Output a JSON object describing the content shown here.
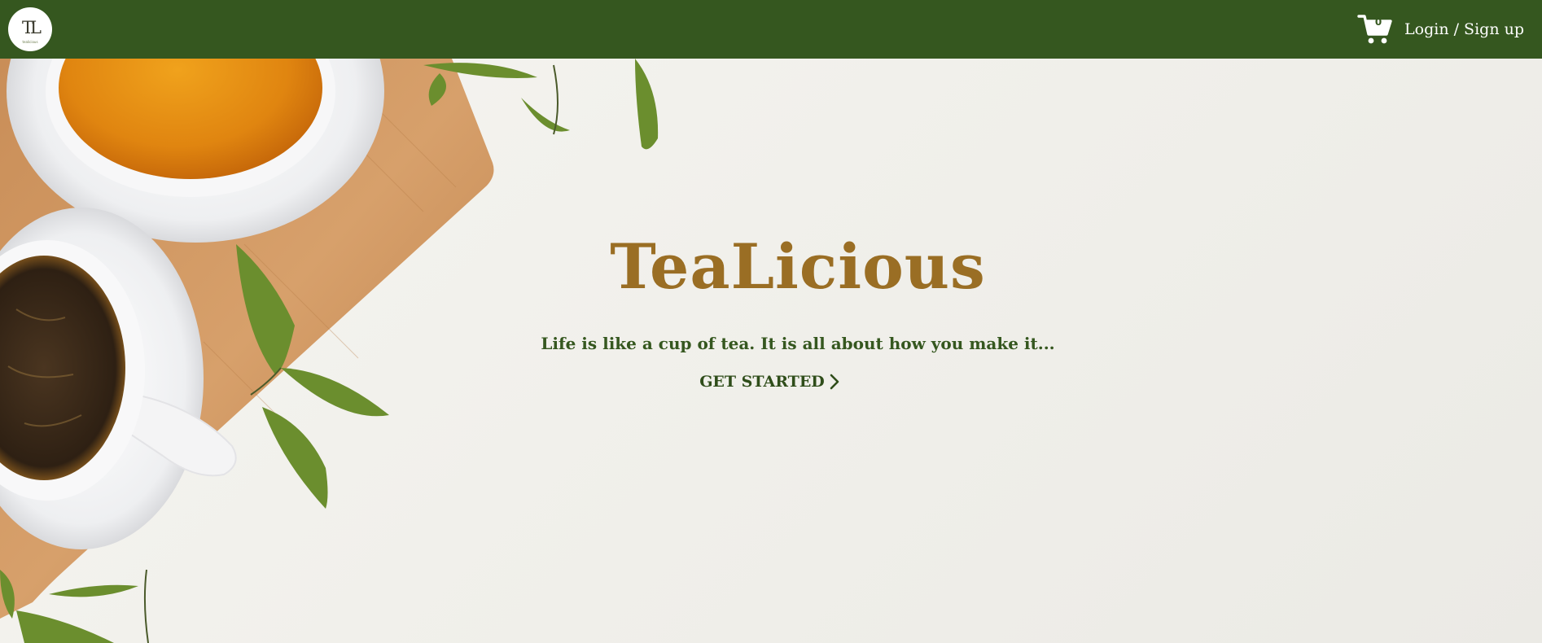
{
  "nav": {
    "logo_text": "TL",
    "logo_subtext": "tealicious",
    "cart_count": "0",
    "login_label": "Login / Sign up"
  },
  "hero": {
    "title": "TeaLicious",
    "tagline": "Life is like a cup of tea. It is all about how you make it...",
    "cta_label": "GET STARTED"
  },
  "icons": {
    "cart": "cart-icon",
    "cta_arrow": "chevron-right-icon",
    "logo": "logo"
  },
  "colors": {
    "navbar": "#35571f",
    "title": "#9a6e24",
    "tagline": "#35571f",
    "background": "#f3f2ee"
  }
}
